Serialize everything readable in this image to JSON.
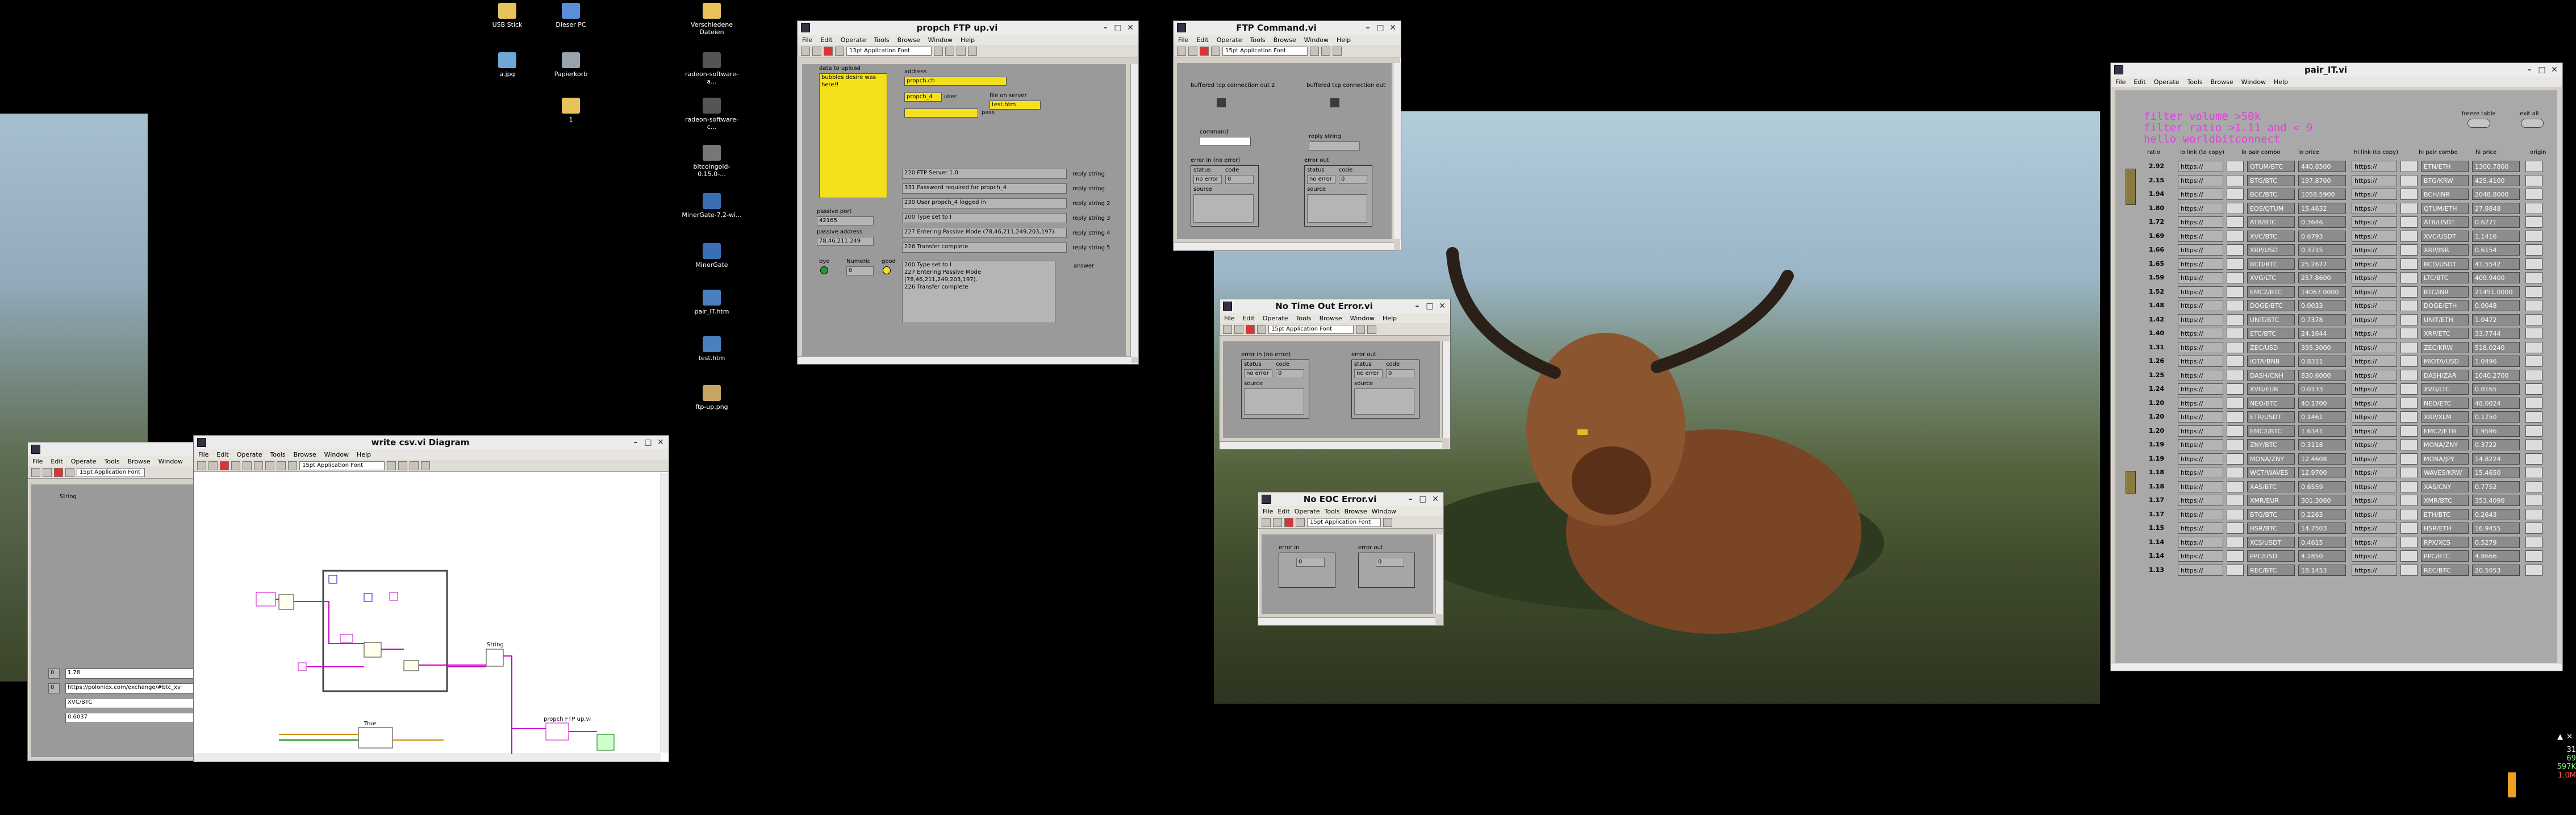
{
  "desktop": {
    "icons": [
      {
        "label": "USB Stick",
        "icon": "folder-icon"
      },
      {
        "label": "Dieser PC",
        "icon": "computer-icon"
      },
      {
        "label": "Verschiedene Dateien",
        "icon": "folder-icon"
      },
      {
        "label": "a.jpg",
        "icon": "image-file-icon"
      },
      {
        "label": "Papierkorb",
        "icon": "recycle-bin-icon"
      },
      {
        "label": "radeon-software-a...",
        "icon": "app-icon"
      },
      {
        "label": "1",
        "icon": "folder-icon"
      },
      {
        "label": "radeon-software-c...",
        "icon": "app-icon"
      },
      {
        "label": "bitcoingold-0.15.0-...",
        "icon": "app-icon"
      },
      {
        "label": "MinerGate-7.2-wi...",
        "icon": "app-icon"
      },
      {
        "label": "MinerGate",
        "icon": "app-icon"
      },
      {
        "label": "pair_IT.htm",
        "icon": "html-file-icon"
      },
      {
        "label": "test.htm",
        "icon": "html-file-icon"
      },
      {
        "label": "ftp-up.png",
        "icon": "image-file-icon"
      }
    ]
  },
  "menu": [
    "File",
    "Edit",
    "Operate",
    "Tools",
    "Browse",
    "Window",
    "Help"
  ],
  "font_select": "15pt Application Font",
  "ftp_upload": {
    "title": "propch FTP up.vi",
    "font_select": "13pt Application Font",
    "data_label": "data to upload",
    "data_value": "bubbles desire was here!!",
    "address_label": "address",
    "address_value": "propch.ch",
    "user_label": "user",
    "user_value": "propch_4",
    "pass_label": "pass",
    "file_label": "file on server",
    "file_value": "test.htm",
    "passive_port_label": "passive port",
    "passive_port_value": "42165",
    "passive_addr_label": "passive address",
    "passive_addr_value": "78.46.211.249",
    "replies": [
      {
        "text": "220 FTP Server 1.0",
        "label": "reply string"
      },
      {
        "text": "331 Password required for propch_4",
        "label": "reply string"
      },
      {
        "text": "230 User propch_4 logged in",
        "label": "reply string 2"
      },
      {
        "text": "200 Type set to I",
        "label": "reply string 3"
      },
      {
        "text": "227 Entering Passive Mode (78,46,211,249,203,197).",
        "label": "reply string 4"
      },
      {
        "text": "226 Transfer complete",
        "label": "reply string 5"
      }
    ],
    "bye_label": "bye",
    "numeric_label": "Numeric",
    "numeric_value": "0",
    "good_label": "good",
    "log_text": "200 Type set to I\n227 Entering Passive Mode (78,46,211,249,203,197).\n226 Transfer complete",
    "answer_label": "answer"
  },
  "ftp_command": {
    "title": "FTP Command.vi",
    "font_select": "15pt Application Font",
    "in_label": "buffered tcp connection in",
    "out_label": "buffered tcp connection out 2",
    "out2_label": "buffered tcp connection out",
    "command_label": "command",
    "reply_label": "reply string",
    "error_in_label": "error in (no error)",
    "error_out_label": "error out",
    "status_label": "status",
    "code_label": "code",
    "source_label": "source",
    "no_error": "no error",
    "zero": "0"
  },
  "no_timeout": {
    "title": "No Time Out Error.vi",
    "font_select": "15pt Application Font",
    "error_in_label": "error in (no error)",
    "error_out_label": "error out",
    "status_label": "status",
    "code_label": "code",
    "source_label": "source",
    "no_error": "no error",
    "zero": "0"
  },
  "no_eoc": {
    "title": "No EOC Error.vi",
    "font_select": "15pt Application Font",
    "error_in_label": "error in",
    "error_out_label": "error out",
    "zero": "0"
  },
  "csv_front": {
    "font_select": "15pt Application Font",
    "string_label": "String",
    "rows": [
      {
        "idx": "0",
        "val": "1.78"
      },
      {
        "idx": "0",
        "val": "https://poloniex.com/exchange/#btc_xv"
      },
      {
        "idx": "",
        "val": "XVC/BTC"
      },
      {
        "idx": "",
        "val": "0.6037"
      }
    ]
  },
  "csv_diagram": {
    "title": "write csv.vi Diagram",
    "font_select": "15pt Application Font",
    "node_labels": [
      "propch FTP up.vi",
      "String",
      "True"
    ]
  },
  "pair_it": {
    "title": "pair_IT.vi",
    "filter_lines": [
      "filter volume >50k",
      "filter ratio >1.11 and < 9",
      "hello worldbitconnect"
    ],
    "freeze_label": "freeze table",
    "exit_label": "exit all",
    "headers": [
      "ratio",
      "lo link (to copy)",
      "lo pair combo",
      "lo price",
      "hi link (to copy)",
      "hi pair combo",
      "hi price",
      "origin"
    ],
    "link_text": "https://",
    "rows": [
      {
        "ratio": "2.92",
        "lo_pair": "QTUM/BTC",
        "lo_price": "440.8500",
        "hi_pair": "ETN/ETH",
        "hi_price": "1300.7800"
      },
      {
        "ratio": "2.15",
        "lo_pair": "BTG/BTC",
        "lo_price": "197.8700",
        "hi_pair": "BTG/KRW",
        "hi_price": "425.4100"
      },
      {
        "ratio": "1.94",
        "lo_pair": "BCC/BTC",
        "lo_price": "1058.5900",
        "hi_pair": "BCH/INR",
        "hi_price": "2048.8000"
      },
      {
        "ratio": "1.80",
        "lo_pair": "EOS/QTUM",
        "lo_price": "15.4632",
        "hi_pair": "QTUM/ETH",
        "hi_price": "27.8848"
      },
      {
        "ratio": "1.72",
        "lo_pair": "ATB/BTC",
        "lo_price": "0.3646",
        "hi_pair": "ATB/USDT",
        "hi_price": "0.6271"
      },
      {
        "ratio": "1.69",
        "lo_pair": "XVC/BTC",
        "lo_price": "0.6793",
        "hi_pair": "XVC/USDT",
        "hi_price": "1.1416"
      },
      {
        "ratio": "1.66",
        "lo_pair": "XRP/USD",
        "lo_price": "0.3715",
        "hi_pair": "XRP/INR",
        "hi_price": "0.6154"
      },
      {
        "ratio": "1.65",
        "lo_pair": "BCD/BTC",
        "lo_price": "25.2677",
        "hi_pair": "BCD/USDT",
        "hi_price": "41.5542"
      },
      {
        "ratio": "1.59",
        "lo_pair": "XVG/LTC",
        "lo_price": "257.8600",
        "hi_pair": "LTC/BTC",
        "hi_price": "409.9400"
      },
      {
        "ratio": "1.52",
        "lo_pair": "EMC2/BTC",
        "lo_price": "14067.0000",
        "hi_pair": "BTC/INR",
        "hi_price": "21451.0000"
      },
      {
        "ratio": "1.48",
        "lo_pair": "DOGE/BTC",
        "lo_price": "0.0033",
        "hi_pair": "DOGE/ETH",
        "hi_price": "0.0048"
      },
      {
        "ratio": "1.42",
        "lo_pair": "UNIT/BTC",
        "lo_price": "0.7378",
        "hi_pair": "UNIT/ETH",
        "hi_price": "1.0472"
      },
      {
        "ratio": "1.40",
        "lo_pair": "ETC/BTC",
        "lo_price": "24.1644",
        "hi_pair": "XRP/ETC",
        "hi_price": "33.7744"
      },
      {
        "ratio": "1.31",
        "lo_pair": "ZEC/USD",
        "lo_price": "395.3000",
        "hi_pair": "ZEC/KRW",
        "hi_price": "518.0240"
      },
      {
        "ratio": "1.26",
        "lo_pair": "IOTA/BNB",
        "lo_price": "0.8311",
        "hi_pair": "MIOTA/USD",
        "hi_price": "1.0496"
      },
      {
        "ratio": "1.25",
        "lo_pair": "DASH/CNH",
        "lo_price": "830.6000",
        "hi_pair": "DASH/ZAR",
        "hi_price": "1040.2700"
      },
      {
        "ratio": "1.24",
        "lo_pair": "XVG/EUR",
        "lo_price": "0.0133",
        "hi_pair": "XVG/LTC",
        "hi_price": "0.0165"
      },
      {
        "ratio": "1.20",
        "lo_pair": "NEO/BTC",
        "lo_price": "40.1700",
        "hi_pair": "NEO/ETC",
        "hi_price": "48.0024"
      },
      {
        "ratio": "1.20",
        "lo_pair": "ETR/USDT",
        "lo_price": "0.1461",
        "hi_pair": "XRP/XLM",
        "hi_price": "0.1750"
      },
      {
        "ratio": "1.20",
        "lo_pair": "EMC2/BTC",
        "lo_price": "1.6341",
        "hi_pair": "EMC2/ETH",
        "hi_price": "1.9596"
      },
      {
        "ratio": "1.19",
        "lo_pair": "ZNY/BTC",
        "lo_price": "0.3118",
        "hi_pair": "MONA/ZNY",
        "hi_price": "0.3722"
      },
      {
        "ratio": "1.19",
        "lo_pair": "MONA/ZNY",
        "lo_price": "12.4608",
        "hi_pair": "MONA/JPY",
        "hi_price": "14.8224"
      },
      {
        "ratio": "1.18",
        "lo_pair": "WCT/WAVES",
        "lo_price": "12.9700",
        "hi_pair": "WAVES/KRW",
        "hi_price": "15.4650"
      },
      {
        "ratio": "1.18",
        "lo_pair": "XAS/BTC",
        "lo_price": "0.6559",
        "hi_pair": "XAS/CNY",
        "hi_price": "0.7752"
      },
      {
        "ratio": "1.17",
        "lo_pair": "XMR/EUR",
        "lo_price": "301.3060",
        "hi_pair": "XMR/BTC",
        "hi_price": "353.4090"
      },
      {
        "ratio": "1.17",
        "lo_pair": "BTG/BTC",
        "lo_price": "0.2263",
        "hi_pair": "ETH/BTC",
        "hi_price": "0.2643"
      },
      {
        "ratio": "1.15",
        "lo_pair": "HSR/BTC",
        "lo_price": "14.7503",
        "hi_pair": "HSR/ETH",
        "hi_price": "16.9455"
      },
      {
        "ratio": "1.14",
        "lo_pair": "XCS/USDT",
        "lo_price": "0.4615",
        "hi_pair": "RPX/XCS",
        "hi_price": "0.5279"
      },
      {
        "ratio": "1.14",
        "lo_pair": "PPC/USD",
        "lo_price": "4.2850",
        "hi_pair": "PPC/BTC",
        "hi_price": "4.8666"
      },
      {
        "ratio": "1.13",
        "lo_pair": "REC/BTC",
        "lo_price": "18.1453",
        "hi_pair": "REC/BTC",
        "hi_price": "20.5053"
      }
    ]
  },
  "tray": {
    "line1": "31",
    "line2": "69",
    "line3": "597K",
    "line4": "1.0M"
  }
}
